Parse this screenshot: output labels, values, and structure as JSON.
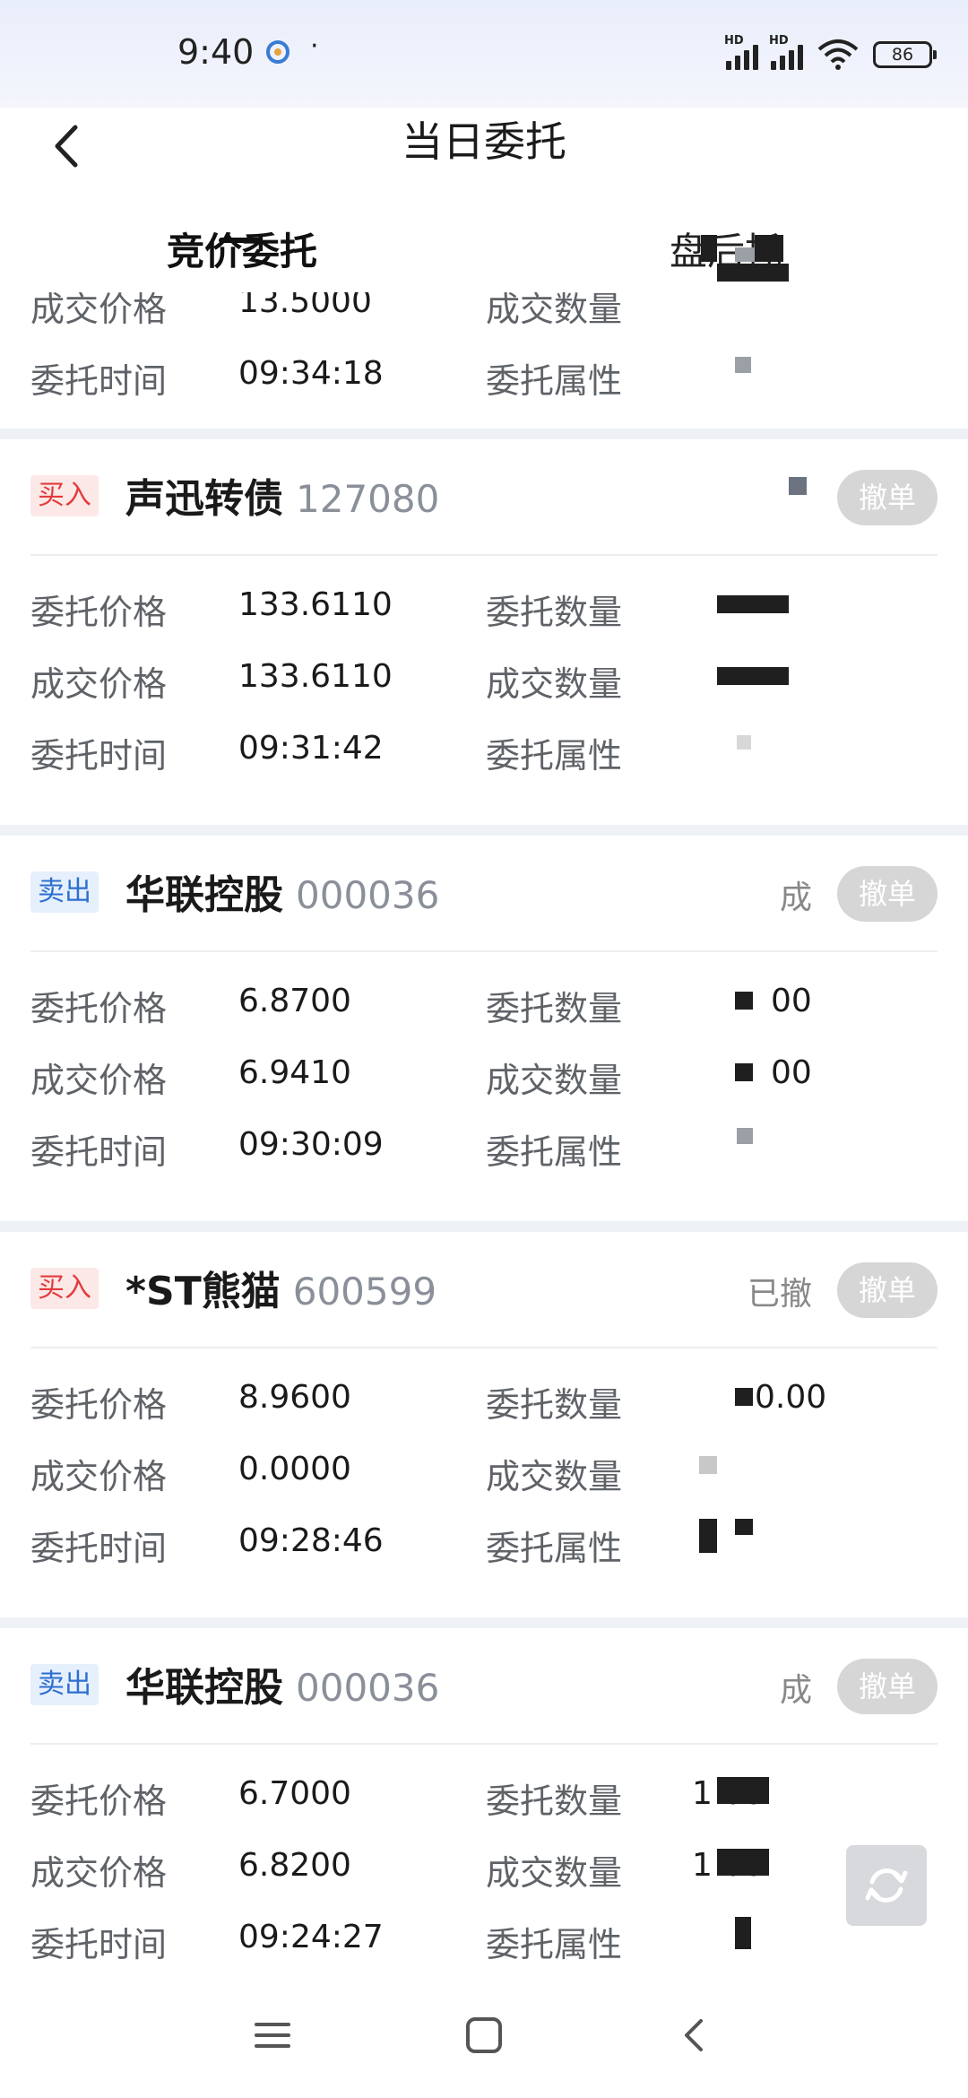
{
  "status_bar": {
    "time": "9:40",
    "dot": "·",
    "battery": "86"
  },
  "header": {
    "title": "当日委托"
  },
  "tabs": [
    {
      "label": "竞价委托",
      "active": true
    },
    {
      "label": "盘后托",
      "active": false
    }
  ],
  "labels": {
    "order_price": "委托价格",
    "deal_price": "成交价格",
    "order_time": "委托时间",
    "order_qty": "委托数量",
    "deal_qty": "成交数量",
    "order_attr": "委托属性",
    "cancel": "撤单"
  },
  "partial_card": {
    "deal_price": "13.5000",
    "time": "09:34:18"
  },
  "orders": [
    {
      "side": "买入",
      "side_type": "buy",
      "name": "声迅转债",
      "code": "127080",
      "status": "",
      "order_price": "133.6110",
      "deal_price": "133.6110",
      "time": "09:31:42",
      "order_qty": "",
      "deal_qty": ""
    },
    {
      "side": "卖出",
      "side_type": "sell",
      "name": "华联控股",
      "code": "000036",
      "status": "成",
      "order_price": "6.8700",
      "deal_price": "6.9410",
      "time": "09:30:09",
      "order_qty": "00",
      "deal_qty": "00"
    },
    {
      "side": "买入",
      "side_type": "buy",
      "name": "*ST熊猫",
      "code": "600599",
      "status": "已撤",
      "order_price": "8.9600",
      "deal_price": "0.0000",
      "time": "09:28:46",
      "order_qty": "0.00",
      "deal_qty": ""
    },
    {
      "side": "卖出",
      "side_type": "sell",
      "name": "华联控股",
      "code": "000036",
      "status": "成",
      "order_price": "6.7000",
      "deal_price": "6.8200",
      "time": "09:24:27",
      "order_qty": "1 00",
      "deal_qty": "1 00"
    }
  ],
  "colors": {
    "buy": "#e23c3c",
    "sell": "#2d6fd0",
    "cancel_bg": "#d6d6d6"
  }
}
